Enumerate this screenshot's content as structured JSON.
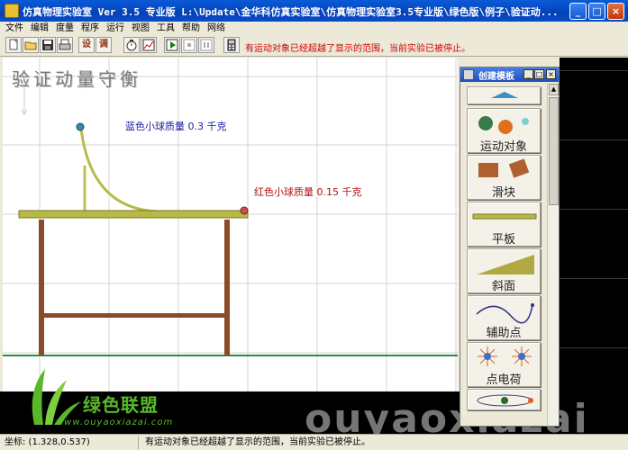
{
  "window": {
    "title": "仿真物理实验室  Ver 3.5 专业版   L:\\Update\\金华科仿真实验室\\仿真物理实验室3.5专业版\\绿色版\\例子\\验证动...",
    "minimize": "_",
    "maximize": "□",
    "close": "×"
  },
  "menu": [
    "文件",
    "编辑",
    "度量",
    "程序",
    "运行",
    "视图",
    "工具",
    "帮助",
    "网络"
  ],
  "toolbar": {
    "new_icon": "new-file-icon",
    "open_icon": "open-folder-icon",
    "save_icon": "save-disk-icon",
    "print_icon": "printer-icon",
    "set_label": "设",
    "tune_label": "调",
    "message": "有运动对象已经超越了显示的范围，当前实验已被停止。"
  },
  "experiment": {
    "title": "验证动量守衡",
    "blue_label": "蓝色小球质量 0.3 千克",
    "red_label": "红色小球质量 0.15 千克",
    "colors": {
      "blue_ball": "#3a88a8",
      "red_ball": "#c85050",
      "track": "#b8b848",
      "table": "#8b4a2a"
    }
  },
  "panel": {
    "title": "创建模板",
    "items": [
      "运动对象",
      "滑块",
      "平板",
      "斜面",
      "辅助点",
      "点电荷"
    ]
  },
  "status": {
    "coords": "坐标: (1.328,0.537)",
    "message": "有运动对象已经超越了显示的范围，当前实验已被停止。"
  },
  "watermark": {
    "brand": "绿色联盟",
    "url": "www.ouyaoxiazai.com",
    "big": "ouyaoxiazai"
  }
}
